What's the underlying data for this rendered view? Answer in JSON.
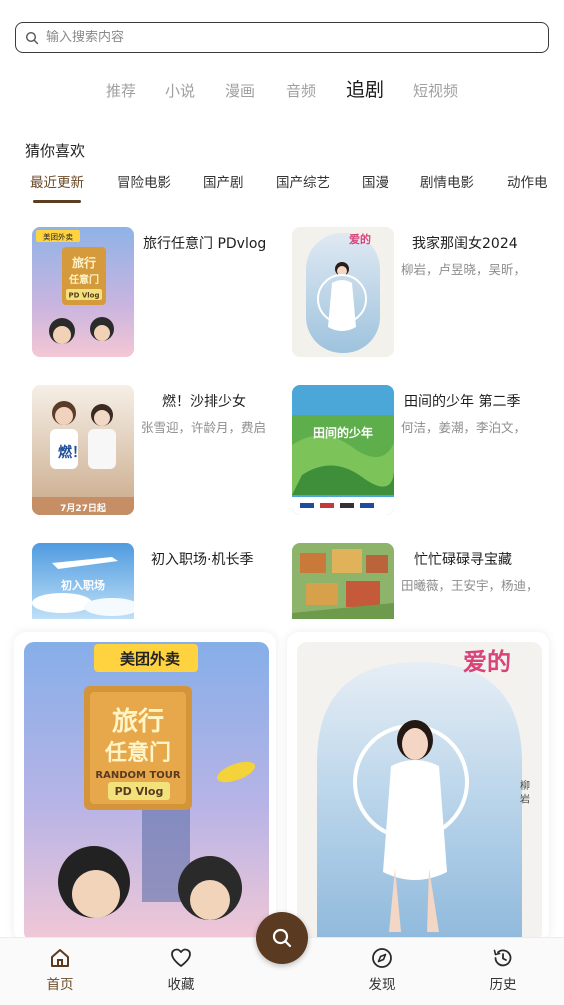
{
  "search": {
    "placeholder": "输入搜索内容",
    "icon": "search-icon"
  },
  "top_tabs": [
    {
      "label": "推荐",
      "active": false
    },
    {
      "label": "小说",
      "active": false
    },
    {
      "label": "漫画",
      "active": false
    },
    {
      "label": "音频",
      "active": false
    },
    {
      "label": "追剧",
      "active": true
    },
    {
      "label": "短视频",
      "active": false
    }
  ],
  "section": {
    "title": "猜你喜欢"
  },
  "categories": [
    {
      "label": "最近更新",
      "active": true
    },
    {
      "label": "冒险电影"
    },
    {
      "label": "国产剧"
    },
    {
      "label": "国产综艺"
    },
    {
      "label": "国漫"
    },
    {
      "label": "剧情电影"
    },
    {
      "label": "动作电"
    }
  ],
  "cards": [
    {
      "title": "旅行任意门 PDvlog",
      "subtitle": "",
      "poster": {
        "brand": "美团外卖",
        "line1": "旅行",
        "line2": "任意门",
        "line3": "PD Vlog"
      }
    },
    {
      "title": "我家那闺女2024",
      "subtitle": "柳岩，卢昱晓，吴昕，",
      "poster": {
        "text": "爱的"
      }
    },
    {
      "title": "燃！沙排少女",
      "subtitle": "张雪迎，许龄月，费启",
      "poster": {
        "text": "燃！",
        "caption": "7月27日起"
      }
    },
    {
      "title": "田间的少年 第二季",
      "subtitle": "何洁，姜潮，李泊文，",
      "poster": {
        "text": "田间的少年"
      }
    },
    {
      "title": "初入职场·机长季",
      "subtitle": "",
      "poster": {
        "text": "初入职场"
      }
    },
    {
      "title": "忙忙碌碌寻宝藏",
      "subtitle": "田曦薇，王安宇，杨迪，",
      "poster": {
        "text": ""
      }
    }
  ],
  "feed": [
    {
      "poster": {
        "brand": "美团外卖",
        "line1": "旅行",
        "line2": "任意门",
        "line3": "PD Vlog",
        "sub": "RANDOM TOUR"
      }
    },
    {
      "poster": {
        "text": "爱的",
        "name": "柳 岩"
      }
    }
  ],
  "nav": [
    {
      "label": "首页",
      "icon": "home-icon",
      "active": true
    },
    {
      "label": "收藏",
      "icon": "heart-icon",
      "active": false
    },
    {
      "label": "发现",
      "icon": "compass-icon",
      "active": false
    },
    {
      "label": "历史",
      "icon": "history-icon",
      "active": false
    }
  ],
  "fab": {
    "icon": "search-icon"
  },
  "colors": {
    "accent": "#5a3b22",
    "active_tab_text": "#6b4a2a",
    "inactive_tab_text": "#a0a0a0"
  }
}
